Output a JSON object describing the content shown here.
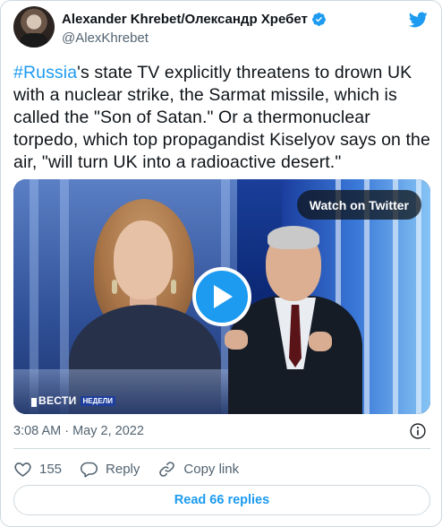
{
  "author": {
    "display_name": "Alexander Khrebet/Олександр Хребет",
    "handle": "@AlexKhrebet",
    "verified": true
  },
  "tweet": {
    "hashtag": "#Russia",
    "text_after_hashtag": "'s state TV explicitly threatens to drown UK with a nuclear strike, the Sarmat missile, which is called the \"Son of Satan.\" Or a thermonuclear torpedo, which top propagandist Kiselyov says on the air, \"will turn UK into a radioactive desert.\""
  },
  "media": {
    "watch_label": "Watch on Twitter",
    "channel_logo": "ВЕСТИ",
    "channel_logo_sub": "НЕДЕЛИ"
  },
  "meta": {
    "timestamp": "3:08 AM · May 2, 2022"
  },
  "actions": {
    "like_count": "155",
    "reply_label": "Reply",
    "copy_link_label": "Copy link"
  },
  "replies_button": "Read 66 replies",
  "colors": {
    "accent": "#1d9bf0",
    "text": "#0f1419",
    "muted": "#536471",
    "border": "#cfd9de"
  },
  "icons": [
    "twitter-bird-icon",
    "verified-badge-icon",
    "play-icon",
    "info-icon",
    "heart-icon",
    "reply-icon",
    "link-icon"
  ]
}
